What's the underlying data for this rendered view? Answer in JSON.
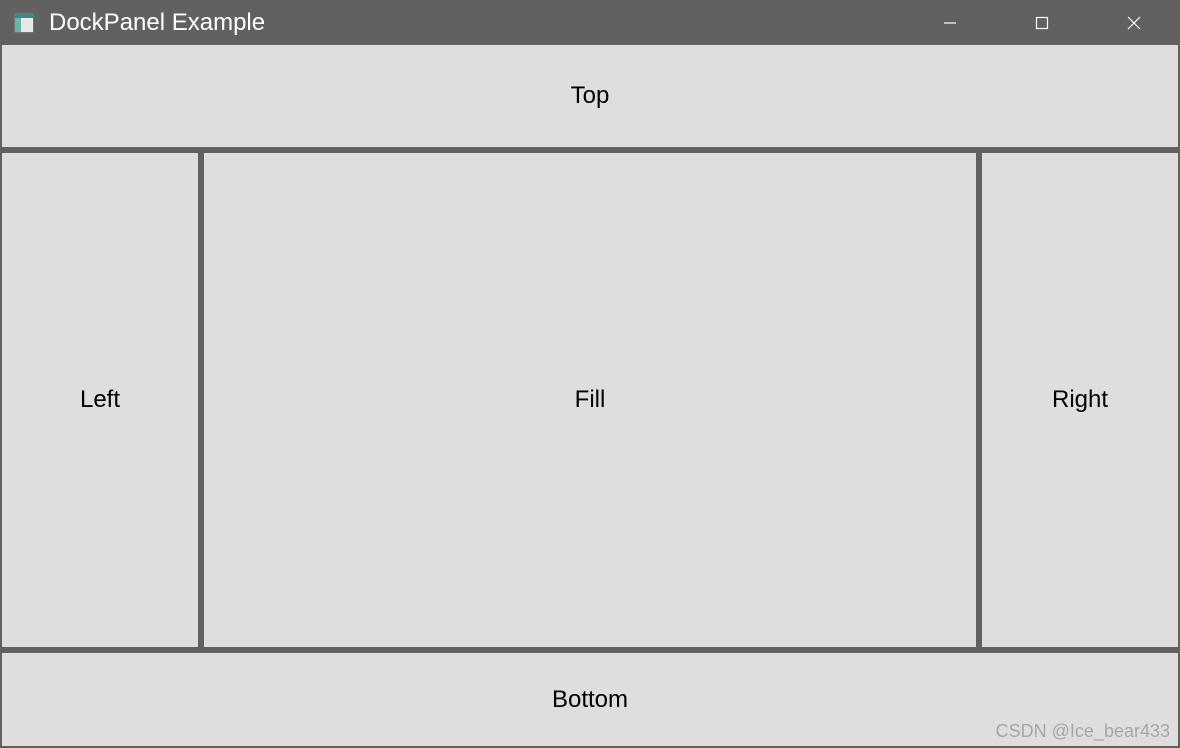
{
  "window": {
    "title": "DockPanel Example"
  },
  "panels": {
    "top": "Top",
    "left": "Left",
    "fill": "Fill",
    "right": "Right",
    "bottom": "Bottom"
  },
  "watermark": "CSDN @Ice_bear433"
}
